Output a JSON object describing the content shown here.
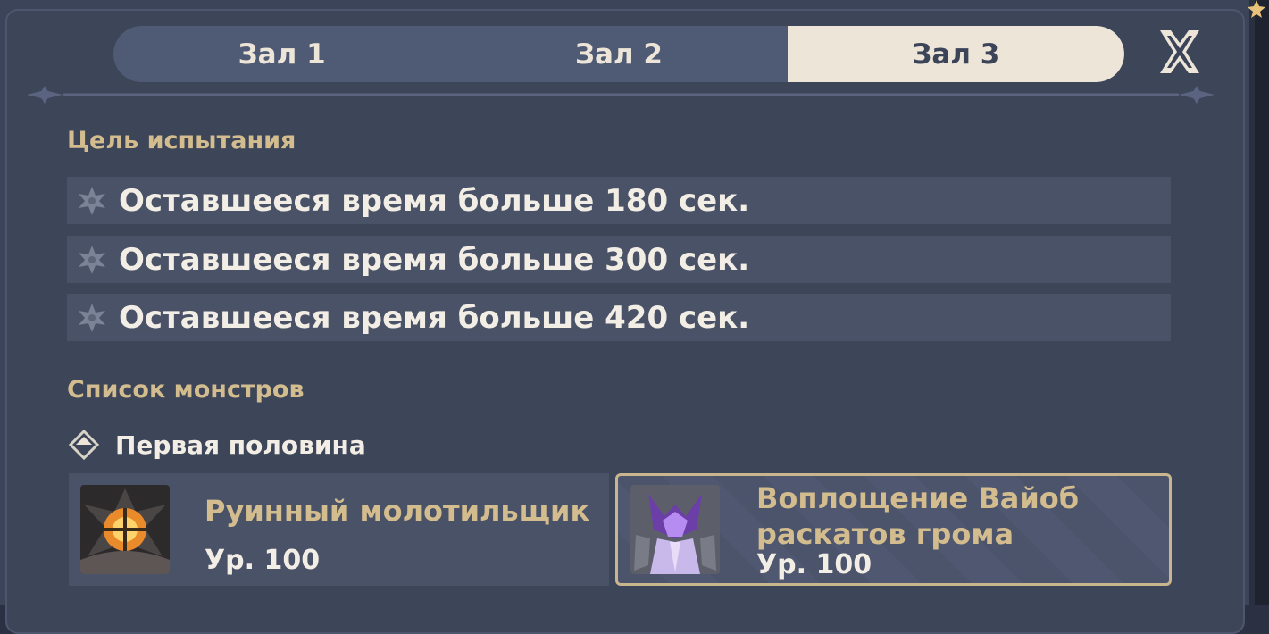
{
  "tabs": [
    {
      "label": "Зал 1",
      "active": false
    },
    {
      "label": "Зал 2",
      "active": false
    },
    {
      "label": "Зал 3",
      "active": true
    }
  ],
  "close_icon": "close-icon",
  "goals": {
    "title": "Цель испытания",
    "items": [
      "Оставшееся время больше 180 сек.",
      "Оставшееся время больше 300 сек.",
      "Оставшееся время больше 420 сек."
    ]
  },
  "monsters": {
    "title": "Список монстров",
    "half_label": "Первая половина",
    "cards": [
      {
        "name": "Руинный молотильщик",
        "level": "Ур. 100",
        "icon": "ruin-grader-portrait"
      },
      {
        "name": "Воплощение Вайоб раскатов грома",
        "level": "Ур. 100",
        "icon": "thunder-manifestation-portrait"
      }
    ]
  },
  "colors": {
    "panel_bg": "#3c4459",
    "gold": "#d3bc8e",
    "text_light": "#f3eee5",
    "tab_active": "#ece5d8",
    "tab_bar": "#4f5a75"
  }
}
